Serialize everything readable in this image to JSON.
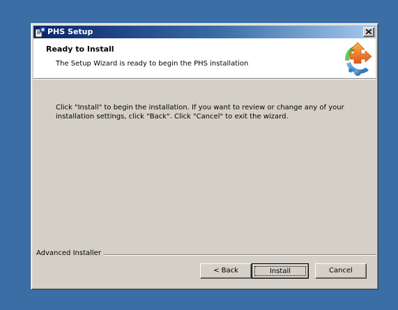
{
  "window": {
    "title": "PHS Setup",
    "close_glyph": "close-icon"
  },
  "header": {
    "title": "Ready to Install",
    "subtitle": "The Setup Wizard is ready to begin the PHS installation"
  },
  "body": {
    "message": "Click \"Install\" to begin the installation.  If you want to review or change any of your installation settings, click \"Back\".  Click \"Cancel\" to exit the wizard."
  },
  "footer": {
    "brand": "Advanced Installer",
    "back_label": "< Back",
    "install_label": "Install",
    "cancel_label": "Cancel"
  },
  "colors": {
    "desktop": "#3a6ea5",
    "titlebar_start": "#0a246a",
    "titlebar_end": "#a6caf0",
    "dialog_face": "#d4d0c8"
  }
}
